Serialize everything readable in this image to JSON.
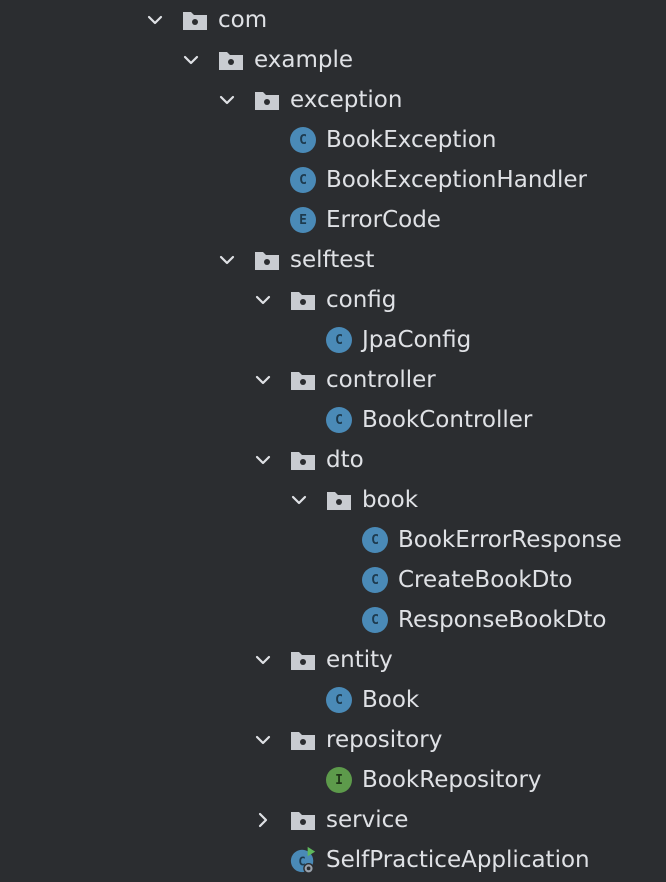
{
  "tree": {
    "nodes": [
      {
        "label": "com",
        "kind": "package",
        "expanded": true
      },
      {
        "label": "example",
        "kind": "package",
        "expanded": true
      },
      {
        "label": "exception",
        "kind": "package",
        "expanded": true
      },
      {
        "label": "BookException",
        "kind": "class",
        "badge": "C"
      },
      {
        "label": "BookExceptionHandler",
        "kind": "class",
        "badge": "C"
      },
      {
        "label": "ErrorCode",
        "kind": "enum",
        "badge": "E"
      },
      {
        "label": "selftest",
        "kind": "package",
        "expanded": true
      },
      {
        "label": "config",
        "kind": "package",
        "expanded": true
      },
      {
        "label": "JpaConfig",
        "kind": "class",
        "badge": "C"
      },
      {
        "label": "controller",
        "kind": "package",
        "expanded": true
      },
      {
        "label": "BookController",
        "kind": "class",
        "badge": "C"
      },
      {
        "label": "dto",
        "kind": "package",
        "expanded": true
      },
      {
        "label": "book",
        "kind": "package",
        "expanded": true
      },
      {
        "label": "BookErrorResponse",
        "kind": "class",
        "badge": "C"
      },
      {
        "label": "CreateBookDto",
        "kind": "class",
        "badge": "C"
      },
      {
        "label": "ResponseBookDto",
        "kind": "class",
        "badge": "C"
      },
      {
        "label": "entity",
        "kind": "package",
        "expanded": true
      },
      {
        "label": "Book",
        "kind": "class",
        "badge": "C"
      },
      {
        "label": "repository",
        "kind": "package",
        "expanded": true
      },
      {
        "label": "BookRepository",
        "kind": "interface",
        "badge": "I"
      },
      {
        "label": "service",
        "kind": "package",
        "expanded": false
      },
      {
        "label": "SelfPracticeApplication",
        "kind": "application",
        "badge": "C"
      }
    ]
  },
  "colors": {
    "background": "#2b2d30",
    "text": "#dfe1e5",
    "chevron": "#dfe1e5",
    "folder": "#c9ccd1",
    "class_badge": "#4a8ab7",
    "interface_badge": "#5d9a4b",
    "run_marker": "#5fb85c"
  }
}
